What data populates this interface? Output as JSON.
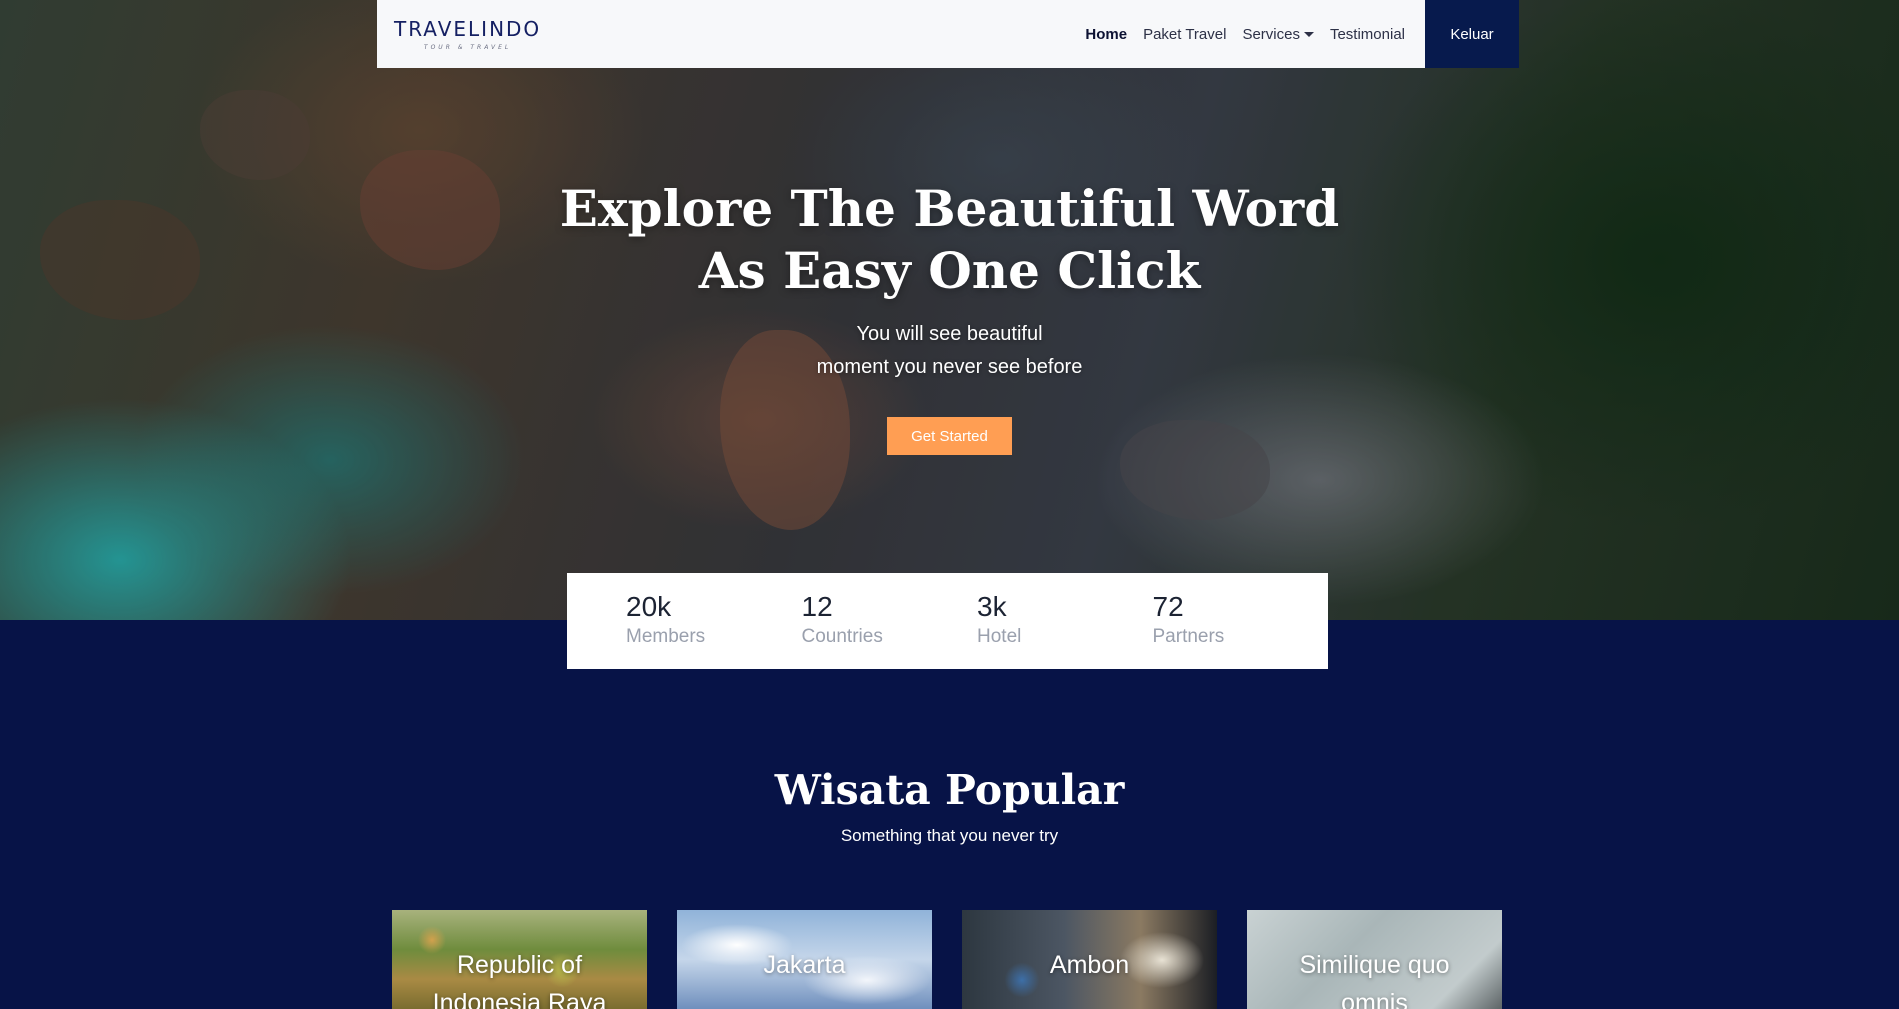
{
  "navbar": {
    "logo_main": "TRAVELINDO",
    "logo_sub": "TOUR & TRAVEL",
    "links": [
      "Home",
      "Paket Travel",
      "Services",
      "Testimonial"
    ],
    "logout_label": "Keluar"
  },
  "hero": {
    "title_line1": "Explore The Beautiful Word",
    "title_line2": "As Easy One Click",
    "subtitle_line1": "You will see beautiful",
    "subtitle_line2": "moment you never see before",
    "cta_label": "Get Started"
  },
  "stats": [
    {
      "value": "20k",
      "label": "Members"
    },
    {
      "value": "12",
      "label": "Countries"
    },
    {
      "value": "3k",
      "label": "Hotel"
    },
    {
      "value": "72",
      "label": "Partners"
    }
  ],
  "popular": {
    "title": "Wisata Popular",
    "subtitle": "Something that you never try",
    "cards": [
      {
        "title": "Republic of Indonesia Raya"
      },
      {
        "title": "Jakarta"
      },
      {
        "title": "Ambon"
      },
      {
        "title": "Similique quo omnis"
      }
    ]
  },
  "colors": {
    "navy": "#071347",
    "cta_orange": "#ff9e53"
  }
}
